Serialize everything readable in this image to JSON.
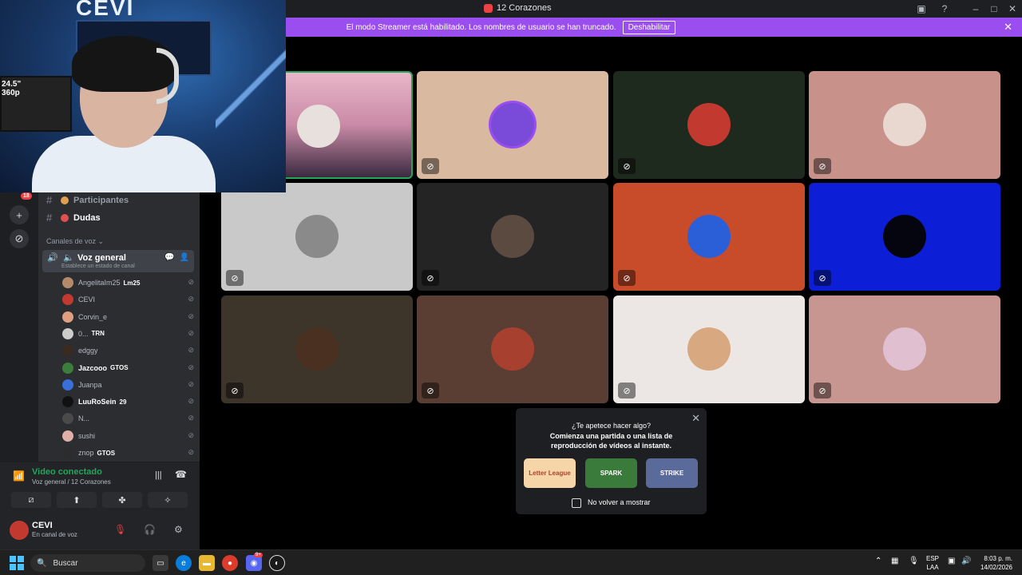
{
  "window": {
    "title": "12 Corazones"
  },
  "banner": {
    "message": "El modo Streamer está habilitado. Los nombres de usuario se han truncado.",
    "disable_button": "Deshabilitar"
  },
  "webcam": {
    "logo_text": "CEVI",
    "monitor_text": "24.5\"\n360p"
  },
  "guild_bar": {
    "notification_badge": "18"
  },
  "channels": {
    "text_channels": [
      {
        "label": "Participantes"
      },
      {
        "label": "Dudas"
      }
    ],
    "voice_category": "Canales de voz",
    "voice_channel": {
      "label": "Voz general",
      "status_placeholder": "Establece un estado de canal"
    },
    "members": [
      {
        "name": "AngelitaIm25",
        "tag": "Lm25",
        "color": "#b58a6b"
      },
      {
        "name": "CEVI",
        "tag": "",
        "color": "#c23a2f"
      },
      {
        "name": "Corvin_e",
        "tag": "",
        "color": "#e0a080"
      },
      {
        "name": "0...",
        "tag": "TRN",
        "color": "#cccccc"
      },
      {
        "name": "edggy",
        "tag": "",
        "color": "#3a2a20"
      },
      {
        "name": "Jazcooo",
        "tag": "GTOS",
        "color": "#3b7d3b",
        "bold": true
      },
      {
        "name": "Juanpa",
        "tag": "",
        "color": "#3a6fd8"
      },
      {
        "name": "LuuRoSein",
        "tag": "29",
        "color": "#111111",
        "bold": true
      },
      {
        "name": "N...",
        "tag": "",
        "color": "#4a4a4a"
      },
      {
        "name": "sushi",
        "tag": "",
        "color": "#e0b0a8"
      },
      {
        "name": "znop",
        "tag": "GTOS",
        "color": "#2c2c2c"
      }
    ]
  },
  "voice_panel": {
    "status": "Video conectado",
    "location": "Voz general / 12 Corazones"
  },
  "user_panel": {
    "name": "CEVI",
    "status": "En canal de voz"
  },
  "tiles": [
    {
      "bg": "#d9b4a0",
      "avatar": "#e8e0dc",
      "stream": true
    },
    {
      "bg": "#d9b9a0",
      "avatar": "#7a4ad8"
    },
    {
      "bg": "#1f2a1e",
      "avatar": "#c23a2f"
    },
    {
      "bg": "#c8928a",
      "avatar": "#e8d8d0"
    },
    {
      "bg": "#c9c9c9",
      "avatar": "#8a8a8a"
    },
    {
      "bg": "#242424",
      "avatar": "#5a4a40"
    },
    {
      "bg": "#c84b2a",
      "avatar": "#2a5fd8"
    },
    {
      "bg": "#0c1fd6",
      "avatar": "#050510"
    },
    {
      "bg": "#3d342a",
      "avatar": "#4a3020"
    },
    {
      "bg": "#5a3e34",
      "avatar": "#a84030"
    },
    {
      "bg": "#ece7e4",
      "avatar": "#d8a880"
    },
    {
      "bg": "#c79690",
      "avatar": "#e0c0d0"
    }
  ],
  "activity": {
    "line1": "¿Te apetece hacer algo?",
    "line2": "Comienza una partida o una lista de\nreproducción de vídeos al instante.",
    "games": [
      {
        "label": "Letter League",
        "bg": "#f6d6a8"
      },
      {
        "label": "SPARK",
        "bg": "#3a7a3a"
      },
      {
        "label": "STRIKE",
        "bg": "#5a6a9a"
      }
    ],
    "dont_show": "No volver a mostrar"
  },
  "taskbar": {
    "search_placeholder": "Buscar",
    "lang_top": "ESP",
    "lang_bottom": "LAA",
    "time": "8:03 p. m.",
    "date": "14/02/2026",
    "discord_badge": "9+"
  },
  "colors": {
    "banner": "#9b4ef0",
    "connected_green": "#23a55a",
    "sidebar": "#2b2d31"
  }
}
